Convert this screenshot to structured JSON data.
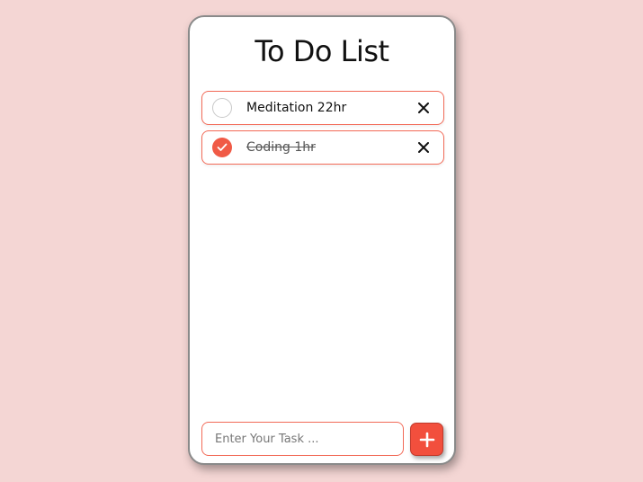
{
  "app": {
    "title": "To Do List"
  },
  "tasks": [
    {
      "label": "Meditation 22hr",
      "completed": false
    },
    {
      "label": "Coding 1hr",
      "completed": true
    }
  ],
  "icons": {
    "complete": "check-icon",
    "remove": "close-icon",
    "add": "plus-icon"
  },
  "input": {
    "value": "",
    "placeholder": "Enter Your Task ..."
  },
  "colors": {
    "accent": "#f05a46",
    "border": "#f26a57",
    "background": "#f4d6d4",
    "card": "#ffffff"
  }
}
